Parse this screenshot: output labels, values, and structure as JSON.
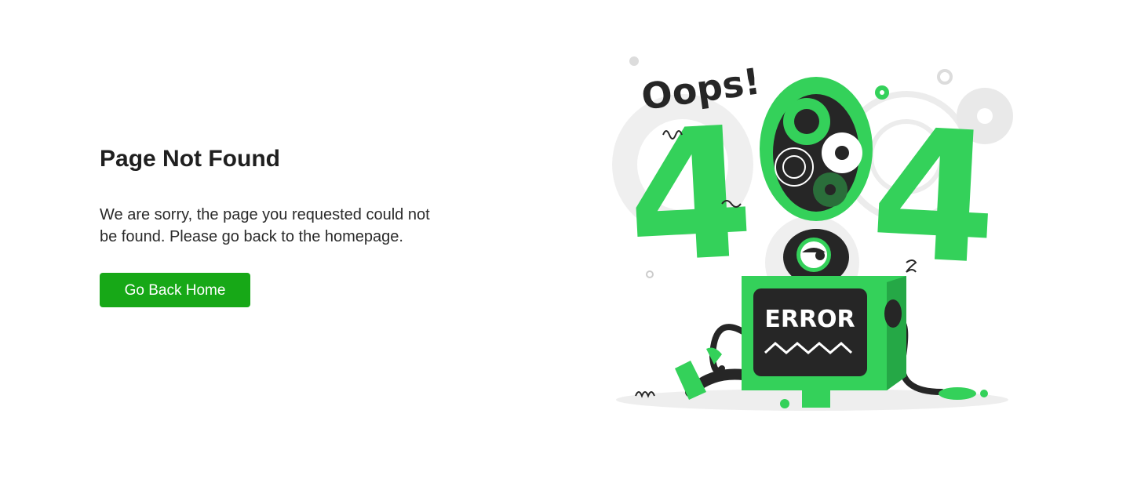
{
  "page": {
    "title": "Page Not Found",
    "message": "We are sorry, the  page you requested could not be found. Please go back to the homepage.",
    "button_label": "Go Back Home"
  },
  "illustration": {
    "oops_text": "Oops!",
    "digit_left": "4",
    "digit_right": "4",
    "screen_text": "ERROR",
    "accent_color": "#34d15a",
    "dark_color": "#262626",
    "button_color": "#17a817"
  }
}
